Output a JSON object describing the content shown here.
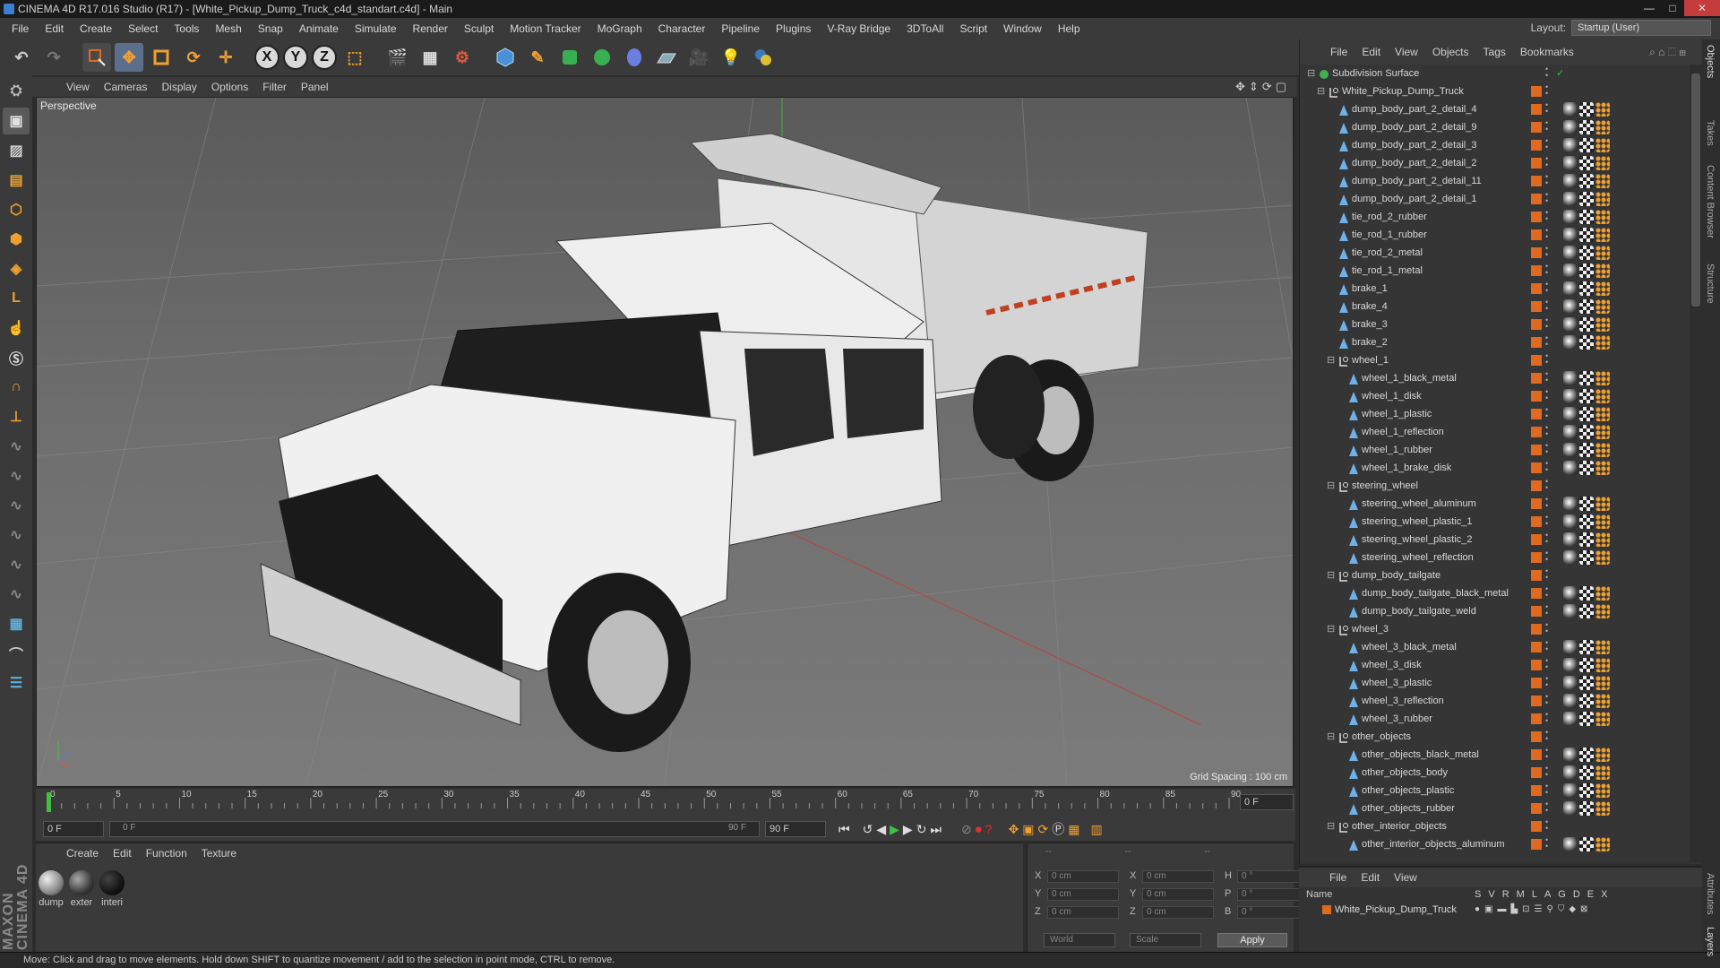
{
  "window": {
    "title": "CINEMA 4D R17.016 Studio (R17) - [White_Pickup_Dump_Truck_c4d_standart.c4d] - Main",
    "buttons": [
      "—",
      "□",
      "✕"
    ]
  },
  "menubar": {
    "items": [
      "File",
      "Edit",
      "Create",
      "Select",
      "Tools",
      "Mesh",
      "Snap",
      "Animate",
      "Simulate",
      "Render",
      "Sculpt",
      "Motion Tracker",
      "MoGraph",
      "Character",
      "Pipeline",
      "Plugins",
      "V-Ray Bridge",
      "3DToAll",
      "Script",
      "Window",
      "Help"
    ],
    "layout_label": "Layout:",
    "layout_value": "Startup (User)"
  },
  "toolbar": {
    "axis_x": "X",
    "axis_y": "Y",
    "axis_z": "Z"
  },
  "viewport": {
    "menu": [
      "View",
      "Cameras",
      "Display",
      "Options",
      "Filter",
      "Panel"
    ],
    "label": "Perspective",
    "grid_spacing": "Grid Spacing : 100 cm",
    "nav_icons": "✥⇕⟳▢"
  },
  "timeline": {
    "ticks": [
      "0",
      "5",
      "10",
      "15",
      "20",
      "25",
      "30",
      "35",
      "40",
      "45",
      "50",
      "55",
      "60",
      "65",
      "70",
      "75",
      "80",
      "85",
      "90"
    ],
    "current_frame_right": "0 F",
    "start_field": "0 F",
    "range_start": "0 F",
    "range_end": "90 F",
    "end_field": "90 F"
  },
  "materials": {
    "menu": [
      "Create",
      "Edit",
      "Function",
      "Texture"
    ],
    "items": [
      {
        "label": "dump",
        "color": "#888888"
      },
      {
        "label": "exter",
        "color": "#3a3a3a"
      },
      {
        "label": "interi",
        "color": "#141414"
      }
    ]
  },
  "coords": {
    "header": [
      "--",
      "--",
      "--"
    ],
    "rows": [
      {
        "a": "X",
        "av": "0 cm",
        "b": "X",
        "bv": "0 cm",
        "c": "H",
        "cv": "0 °"
      },
      {
        "a": "Y",
        "av": "0 cm",
        "b": "Y",
        "bv": "0 cm",
        "c": "P",
        "cv": "0 °"
      },
      {
        "a": "Z",
        "av": "0 cm",
        "b": "Z",
        "bv": "0 cm",
        "c": "B",
        "cv": "0 °"
      }
    ],
    "mode1": "World",
    "mode2": "Scale",
    "apply": "Apply"
  },
  "status": "Move: Click and drag to move elements. Hold down SHIFT to quantize movement / add to the selection in point mode, CTRL to remove.",
  "objects": {
    "menu": [
      "File",
      "Edit",
      "View",
      "Objects",
      "Tags",
      "Bookmarks"
    ],
    "rows": [
      {
        "name": "Subdivision Surface",
        "level": 0,
        "kind": "subdiv"
      },
      {
        "name": "White_Pickup_Dump_Truck",
        "level": 1,
        "kind": "null"
      },
      {
        "name": "dump_body_part_2_detail_4",
        "level": 2,
        "kind": "mesh"
      },
      {
        "name": "dump_body_part_2_detail_9",
        "level": 2,
        "kind": "mesh"
      },
      {
        "name": "dump_body_part_2_detail_3",
        "level": 2,
        "kind": "mesh"
      },
      {
        "name": "dump_body_part_2_detail_2",
        "level": 2,
        "kind": "mesh"
      },
      {
        "name": "dump_body_part_2_detail_11",
        "level": 2,
        "kind": "mesh"
      },
      {
        "name": "dump_body_part_2_detail_1",
        "level": 2,
        "kind": "mesh"
      },
      {
        "name": "tie_rod_2_rubber",
        "level": 2,
        "kind": "mesh"
      },
      {
        "name": "tie_rod_1_rubber",
        "level": 2,
        "kind": "mesh"
      },
      {
        "name": "tie_rod_2_metal",
        "level": 2,
        "kind": "mesh"
      },
      {
        "name": "tie_rod_1_metal",
        "level": 2,
        "kind": "mesh"
      },
      {
        "name": "brake_1",
        "level": 2,
        "kind": "mesh"
      },
      {
        "name": "brake_4",
        "level": 2,
        "kind": "mesh"
      },
      {
        "name": "brake_3",
        "level": 2,
        "kind": "mesh"
      },
      {
        "name": "brake_2",
        "level": 2,
        "kind": "mesh"
      },
      {
        "name": "wheel_1",
        "level": 2,
        "kind": "null"
      },
      {
        "name": "wheel_1_black_metal",
        "level": 3,
        "kind": "mesh"
      },
      {
        "name": "wheel_1_disk",
        "level": 3,
        "kind": "mesh"
      },
      {
        "name": "wheel_1_plastic",
        "level": 3,
        "kind": "mesh"
      },
      {
        "name": "wheel_1_reflection",
        "level": 3,
        "kind": "mesh"
      },
      {
        "name": "wheel_1_rubber",
        "level": 3,
        "kind": "mesh"
      },
      {
        "name": "wheel_1_brake_disk",
        "level": 3,
        "kind": "mesh"
      },
      {
        "name": "steering_wheel",
        "level": 2,
        "kind": "null"
      },
      {
        "name": "steering_wheel_aluminum",
        "level": 3,
        "kind": "mesh"
      },
      {
        "name": "steering_wheel_plastic_1",
        "level": 3,
        "kind": "mesh"
      },
      {
        "name": "steering_wheel_plastic_2",
        "level": 3,
        "kind": "mesh"
      },
      {
        "name": "steering_wheel_reflection",
        "level": 3,
        "kind": "mesh"
      },
      {
        "name": "dump_body_tailgate",
        "level": 2,
        "kind": "null"
      },
      {
        "name": "dump_body_tailgate_black_metal",
        "level": 3,
        "kind": "mesh"
      },
      {
        "name": "dump_body_tailgate_weld",
        "level": 3,
        "kind": "mesh"
      },
      {
        "name": "wheel_3",
        "level": 2,
        "kind": "null"
      },
      {
        "name": "wheel_3_black_metal",
        "level": 3,
        "kind": "mesh"
      },
      {
        "name": "wheel_3_disk",
        "level": 3,
        "kind": "mesh"
      },
      {
        "name": "wheel_3_plastic",
        "level": 3,
        "kind": "mesh"
      },
      {
        "name": "wheel_3_reflection",
        "level": 3,
        "kind": "mesh"
      },
      {
        "name": "wheel_3_rubber",
        "level": 3,
        "kind": "mesh"
      },
      {
        "name": "other_objects",
        "level": 2,
        "kind": "null"
      },
      {
        "name": "other_objects_black_metal",
        "level": 3,
        "kind": "mesh"
      },
      {
        "name": "other_objects_body",
        "level": 3,
        "kind": "mesh"
      },
      {
        "name": "other_objects_plastic",
        "level": 3,
        "kind": "mesh"
      },
      {
        "name": "other_objects_rubber",
        "level": 3,
        "kind": "mesh"
      },
      {
        "name": "other_interior_objects",
        "level": 2,
        "kind": "null"
      },
      {
        "name": "other_interior_objects_aluminum",
        "level": 3,
        "kind": "mesh"
      }
    ]
  },
  "layers": {
    "menu": [
      "File",
      "Edit",
      "View"
    ],
    "header_name": "Name",
    "header_cols": [
      "S",
      "V",
      "R",
      "M",
      "L",
      "A",
      "G",
      "D",
      "E",
      "X"
    ],
    "row_name": "White_Pickup_Dump_Truck"
  },
  "sidetabs": [
    "Objects",
    "Takes",
    "Content Browser",
    "Structure",
    "Attributes",
    "Layers"
  ],
  "brand": "MAXON CINEMA 4D"
}
